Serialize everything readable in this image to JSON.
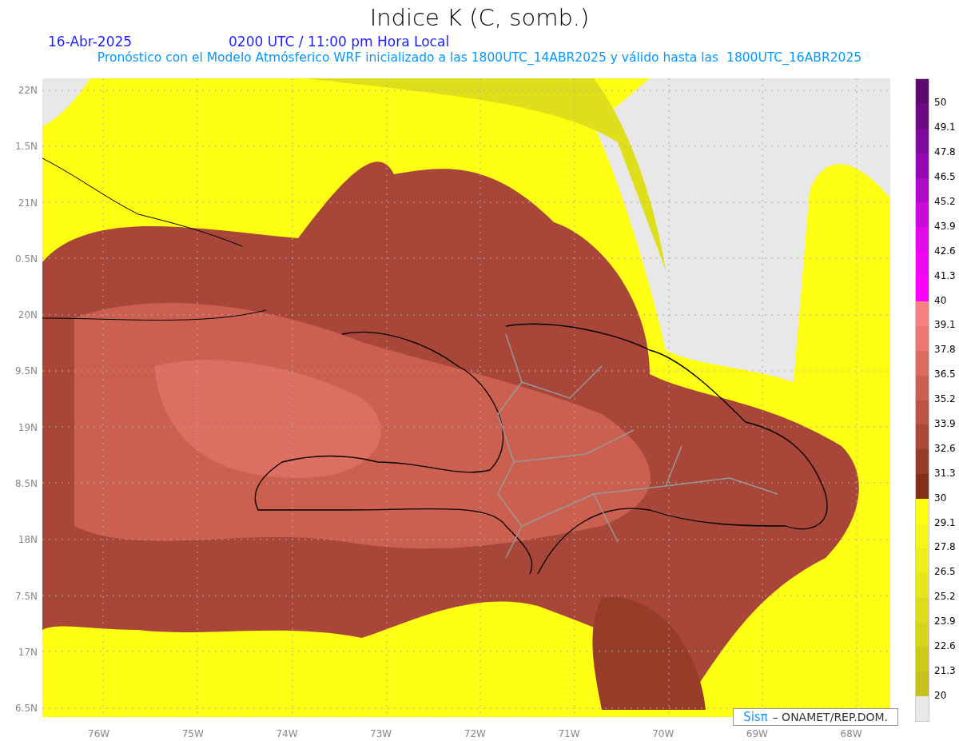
{
  "title": "Indice K (C, somb.)",
  "date": "16-Abr-2025",
  "time": "0200 UTC / 11:00 pm Hora Local",
  "subtitle": "Pronóstico con el Modelo Atmósferico WRF inicializado a las 1800UTC_14ABR2025 y válido hasta las  1800UTC_16ABR2025",
  "y_labels": [
    "22N",
    "1.5N",
    "21N",
    "0.5N",
    "20N",
    "9.5N",
    "19N",
    "8.5N",
    "18N",
    "7.5N",
    "17N",
    "6.5N"
  ],
  "x_labels": [
    "76W",
    "75W",
    "74W",
    "73W",
    "72W",
    "71W",
    "70W",
    "69W",
    "68W"
  ],
  "credit": {
    "brand": "Sisπ",
    "text": "–  ONAMET/REP.DOM."
  },
  "legend": {
    "bins": [
      {
        "color": "#5c0a6e"
      },
      {
        "color": "#6c0a84"
      },
      {
        "color": "#7e0a9c"
      },
      {
        "color": "#9408b4"
      },
      {
        "color": "#b008c8"
      },
      {
        "color": "#cc08dc"
      },
      {
        "color": "#e208ea"
      },
      {
        "color": "#f204f4"
      },
      {
        "color": "#ff00ff"
      },
      {
        "color": "#f48282"
      },
      {
        "color": "#e87870"
      },
      {
        "color": "#da6c60"
      },
      {
        "color": "#cc6050"
      },
      {
        "color": "#bc5444"
      },
      {
        "color": "#aa4838"
      },
      {
        "color": "#983c2a"
      },
      {
        "color": "#82301a"
      },
      {
        "color": "#ffff14"
      },
      {
        "color": "#f6f61a"
      },
      {
        "color": "#eeee1a"
      },
      {
        "color": "#e6e61a"
      },
      {
        "color": "#dcdc1a"
      },
      {
        "color": "#d4d41a"
      },
      {
        "color": "#cbcb1a"
      },
      {
        "color": "#c2c21a"
      },
      {
        "color": "#e8e8e8"
      }
    ],
    "labels": [
      "50",
      "49.1",
      "47.8",
      "46.5",
      "45.2",
      "43.9",
      "42.6",
      "41.3",
      "40",
      "39.1",
      "37.8",
      "36.5",
      "35.2",
      "33.9",
      "32.6",
      "31.3",
      "30",
      "29.1",
      "27.8",
      "26.5",
      "25.2",
      "23.9",
      "22.6",
      "21.3",
      "20"
    ]
  }
}
